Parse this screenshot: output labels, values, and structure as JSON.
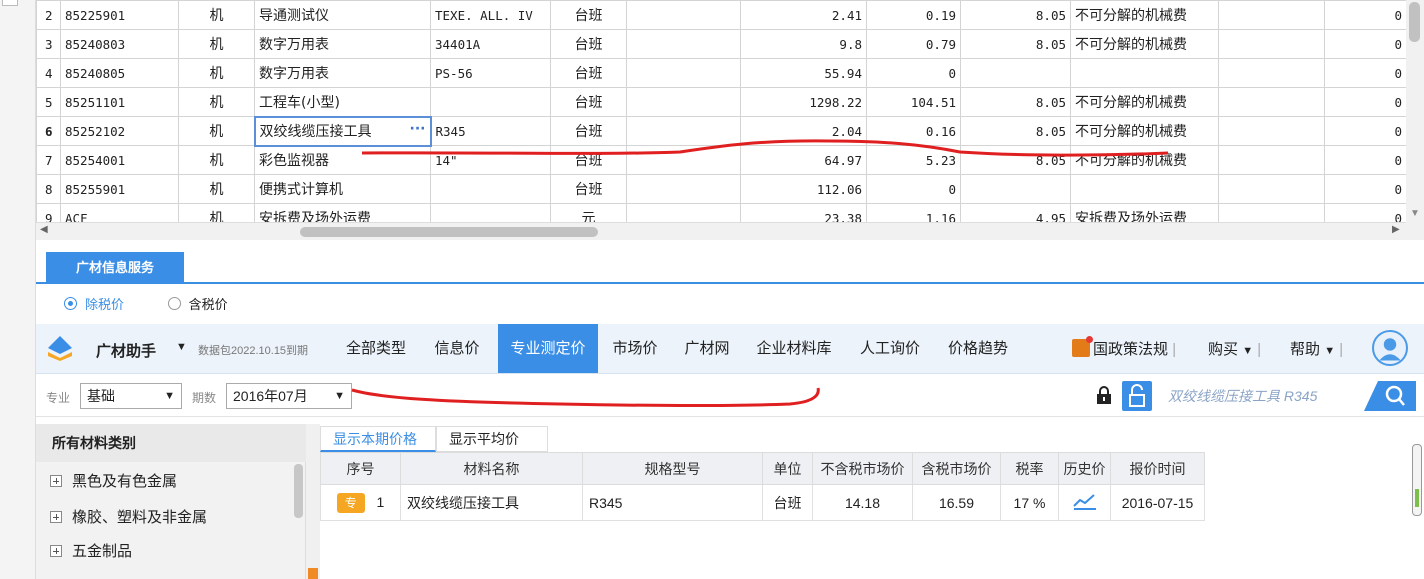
{
  "grid": {
    "rows": [
      {
        "num": "2",
        "code": "85225901",
        "type": "机",
        "name": "导通测试仪",
        "spec": "TEXE. ALL. IV",
        "unit": "台班",
        "price": "2.41",
        "v2": "0.19",
        "rate": "8.05",
        "cat": "不可分解的机械费",
        "z": "0"
      },
      {
        "num": "3",
        "code": "85240803",
        "type": "机",
        "name": "数字万用表",
        "spec": "34401A",
        "unit": "台班",
        "price": "9.8",
        "v2": "0.79",
        "rate": "8.05",
        "cat": "不可分解的机械费",
        "z": "0"
      },
      {
        "num": "4",
        "code": "85240805",
        "type": "机",
        "name": "数字万用表",
        "spec": "PS-56",
        "unit": "台班",
        "price": "55.94",
        "v2": "0",
        "rate": "",
        "cat": "",
        "z": "0"
      },
      {
        "num": "5",
        "code": "85251101",
        "type": "机",
        "name": "工程车(小型)",
        "spec": "",
        "unit": "台班",
        "price": "1298.22",
        "v2": "104.51",
        "rate": "8.05",
        "cat": "不可分解的机械费",
        "z": "0"
      },
      {
        "num": "6",
        "code": "85252102",
        "type": "机",
        "name": "双绞线缆压接工具",
        "spec": "R345",
        "unit": "台班",
        "price": "2.04",
        "v2": "0.16",
        "rate": "8.05",
        "cat": "不可分解的机械费",
        "z": "0"
      },
      {
        "num": "7",
        "code": "85254001",
        "type": "机",
        "name": "彩色监视器",
        "spec": "14\"",
        "unit": "台班",
        "price": "64.97",
        "v2": "5.23",
        "rate": "8.05",
        "cat": "不可分解的机械费",
        "z": "0"
      },
      {
        "num": "8",
        "code": "85255901",
        "type": "机",
        "name": "便携式计算机",
        "spec": "",
        "unit": "台班",
        "price": "112.06",
        "v2": "0",
        "rate": "",
        "cat": "",
        "z": "0"
      },
      {
        "num": "9",
        "code": "ACF",
        "type": "机",
        "name": "安拆费及场外运费",
        "spec": "",
        "unit": "元",
        "price": "23.38",
        "v2": "1.16",
        "rate": "4.95",
        "cat": "安拆费及场外运费",
        "z": "0"
      }
    ],
    "more_icon": "ellipsis-icon"
  },
  "panel": {
    "tab_label": "广材信息服务",
    "radio_exclude_tax": "除税价",
    "radio_include_tax": "含税价",
    "brand": "广材助手",
    "package_info": "数据包2022.10.15到期",
    "nav": [
      "全部类型",
      "信息价",
      "专业测定价",
      "市场价",
      "广材网",
      "企业材料库",
      "人工询价",
      "价格趋势"
    ],
    "policy": "国政策法规",
    "buy": "购买",
    "help": "帮助",
    "filter_major_label": "专业",
    "filter_major_value": "基础",
    "filter_period_label": "期数",
    "filter_period_value": "2016年07月",
    "search_value": "双绞线缆压接工具 R345",
    "tree_header": "所有材料类别",
    "tree_items": [
      "黑色及有色金属",
      "橡胶、塑料及非金属",
      "五金制品"
    ],
    "subtab_current": "显示本期价格",
    "subtab_avg": "显示平均价",
    "columns": [
      "序号",
      "材料名称",
      "规格型号",
      "单位",
      "不含税市场价",
      "含税市场价",
      "税率",
      "历史价",
      "报价时间"
    ],
    "result": {
      "badge": "专",
      "seq": "1",
      "name": "双绞线缆压接工具",
      "spec": "R345",
      "unit": "台班",
      "ex_tax": "14.18",
      "in_tax": "16.59",
      "rate": "17 %",
      "history_icon": "trend-chart-icon",
      "date": "2016-07-15"
    }
  },
  "colors": {
    "accent": "#3a8ee6",
    "annotation": "#e02020",
    "badge": "#f5a623"
  }
}
